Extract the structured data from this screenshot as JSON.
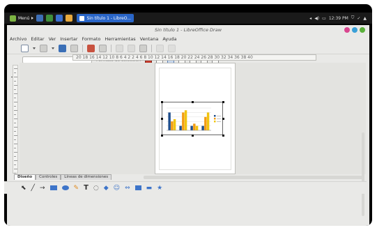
{
  "panel": {
    "menu_label": "Menú",
    "task_label": "Sin título 1 - LibreO...",
    "clock": "12:39 PM"
  },
  "window": {
    "title": "Sin título 1 - LibreOffice Draw"
  },
  "menubar": [
    "Archivo",
    "Editar",
    "Ver",
    "Insertar",
    "Formato",
    "Herramientas",
    "Ventana",
    "Ayuda"
  ],
  "toolbar2": {
    "style_label": "Formato de selección"
  },
  "ruler": {
    "text": "20 18 16 14 12 10  8   6   4   2        2   4   6   8  10 12 14 16 18 20 22 24 26 28 30 32 34 36 38 40"
  },
  "tabs": [
    "Diseño",
    "Controles",
    "Líneas de dimensiones"
  ],
  "colors": {
    "bar_blue": "#1f4e8c",
    "bar_orange": "#f39c12",
    "bar_yellow": "#f1c40f"
  },
  "chart_data": {
    "type": "bar",
    "categories": [
      "1",
      "2",
      "3",
      "4"
    ],
    "series": [
      {
        "name": "",
        "values": [
          8,
          2,
          2,
          2
        ]
      },
      {
        "name": "",
        "values": [
          4,
          8,
          3,
          6
        ]
      },
      {
        "name": "",
        "values": [
          5,
          9,
          2,
          8
        ]
      }
    ],
    "ylim": [
      0,
      10
    ],
    "legend": "right"
  }
}
